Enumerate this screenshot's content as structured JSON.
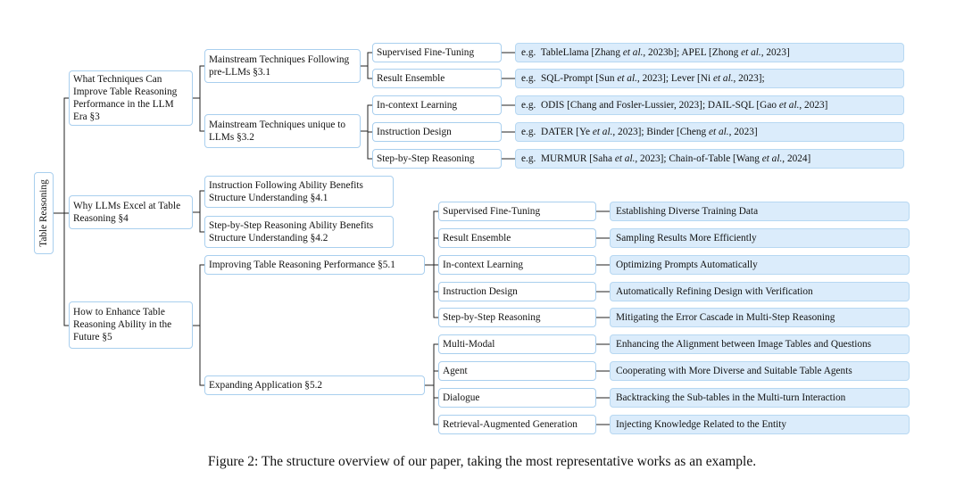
{
  "root": "Table Reasoning",
  "level1": [
    "What Techniques Can Improve Table Reasoning Performance in the LLM Era §3",
    "Why LLMs Excel at Table Reasoning §4",
    "How to Enhance Table Reasoning Ability in the Future §5"
  ],
  "sec3": {
    "mainstream_following": "Mainstream Techniques Following pre-LLMs §3.1",
    "mainstream_unique": "Mainstream Techniques unique to LLMs §3.2",
    "techniques": [
      {
        "label": "Supervised Fine-Tuning",
        "example": "e.g.  TableLlama [Zhang et al., 2023b]; APEL [Zhong et al., 2023]"
      },
      {
        "label": "Result Ensemble",
        "example": "e.g.  SQL-Prompt [Sun et al., 2023]; Lever [Ni et al., 2023];"
      },
      {
        "label": "In-context Learning",
        "example": "e.g.  ODIS [Chang and Fosler-Lussier, 2023]; DAIL-SQL [Gao et al., 2023]"
      },
      {
        "label": "Instruction Design",
        "example": "e.g.  DATER [Ye et al., 2023]; Binder [Cheng et al., 2023]"
      },
      {
        "label": "Step-by-Step Reasoning",
        "example": "e.g.  MURMUR [Saha et al., 2023]; Chain-of-Table [Wang et al., 2024]"
      }
    ]
  },
  "sec4": [
    "Instruction Following Ability Benefits Structure Understanding §4.1",
    "Step-by-Step Reasoning Ability Benefits Structure Understanding §4.2"
  ],
  "sec5": {
    "improving": "Improving Table Reasoning Performance §5.1",
    "expanding": "Expanding Application §5.2",
    "improving_items": [
      {
        "label": "Supervised Fine-Tuning",
        "leaf": "Establishing Diverse Training Data"
      },
      {
        "label": "Result Ensemble",
        "leaf": "Sampling Results More Efficiently"
      },
      {
        "label": "In-context Learning",
        "leaf": "Optimizing Prompts Automatically"
      },
      {
        "label": "Instruction Design",
        "leaf": "Automatically Refining Design with Verification"
      },
      {
        "label": "Step-by-Step Reasoning",
        "leaf": "Mitigating the Error Cascade in Multi-Step Reasoning"
      }
    ],
    "expanding_items": [
      {
        "label": "Multi-Modal",
        "leaf": "Enhancing the Alignment between Image Tables and Questions"
      },
      {
        "label": "Agent",
        "leaf": "Cooperating with More Diverse and Suitable Table Agents"
      },
      {
        "label": "Dialogue",
        "leaf": "Backtracking the Sub-tables in the Multi-turn Interaction"
      },
      {
        "label": "Retrieval-Augmented Generation",
        "leaf": "Injecting Knowledge Related to the Entity"
      }
    ]
  },
  "caption": "Figure 2: The structure overview of our paper, taking the most representative works as an example."
}
